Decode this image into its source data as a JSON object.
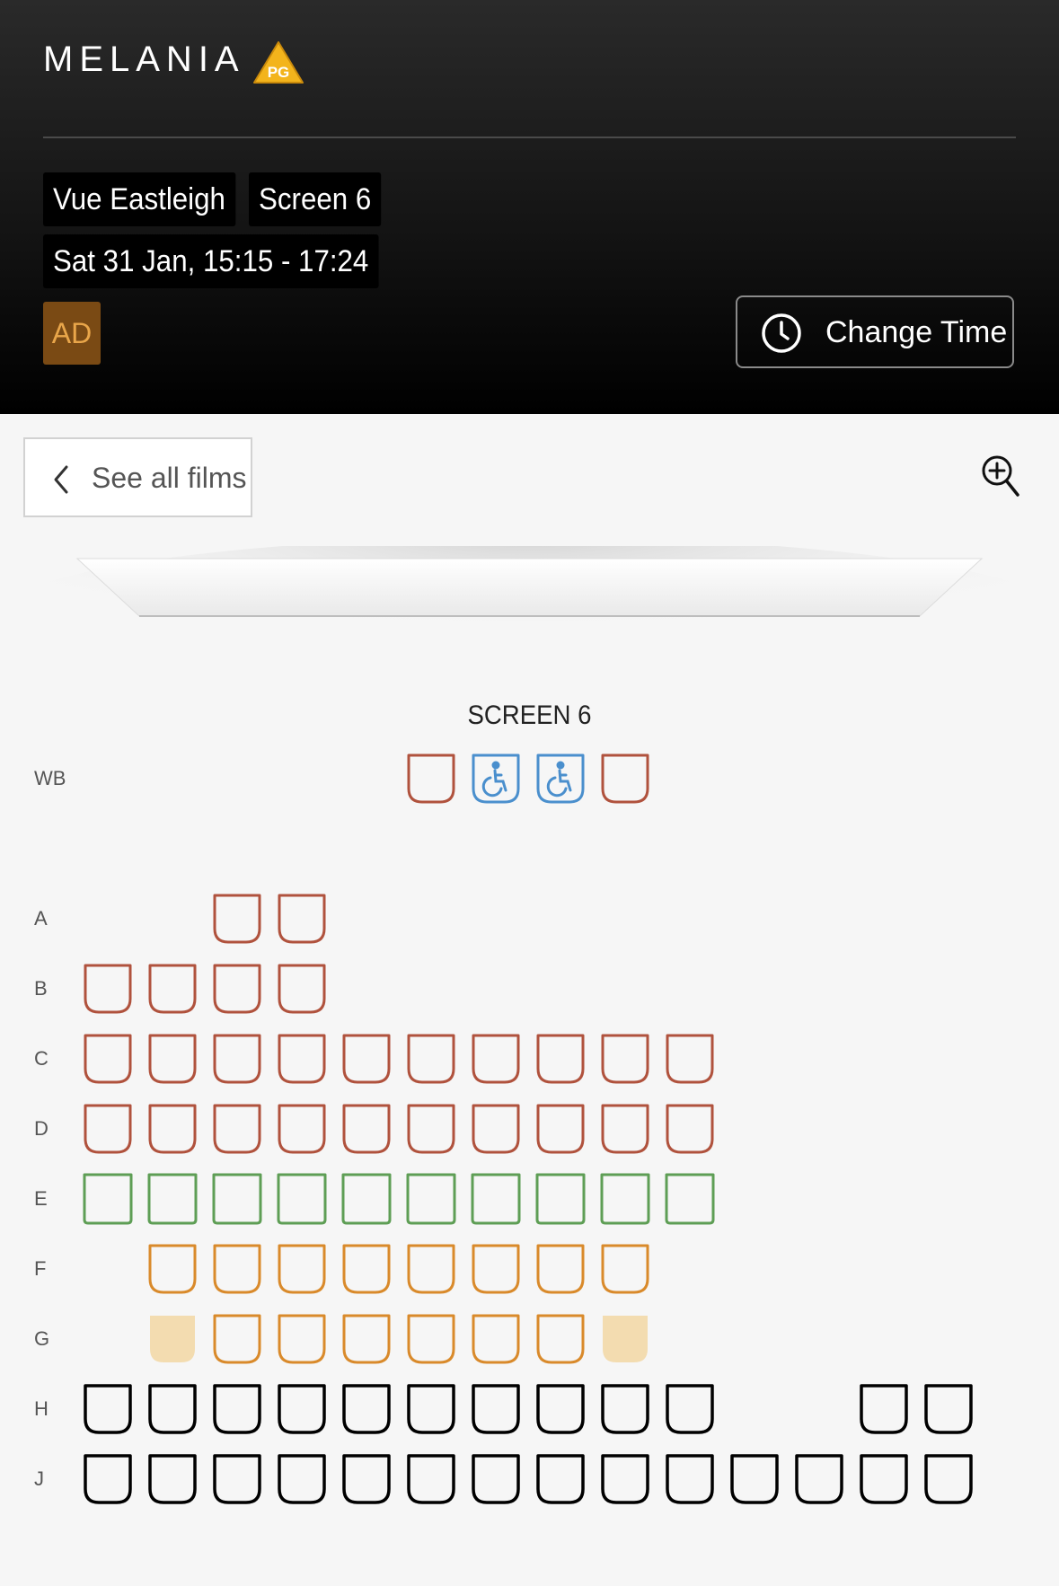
{
  "header": {
    "film_title": "MELANIA",
    "rating": "PG",
    "cinema": "Vue Eastleigh",
    "screen": "Screen 6",
    "datetime": "Sat 31 Jan, 15:15 - 17:24",
    "accessibility_tag": "AD",
    "change_time_label": "Change Time"
  },
  "nav": {
    "back_label": "See all films"
  },
  "seat_map": {
    "screen_label": "SCREEN 6",
    "colors": {
      "standard": "#b0523d",
      "wheelchair": "#4a8fcd",
      "recliner": "#5e9e55",
      "premium": "#d98a2b",
      "premium_taken": "#f3dcb0",
      "basic": "#000000"
    },
    "rows": [
      {
        "label": "WB",
        "seats": [
          {
            "col": 5,
            "type": "standard"
          },
          {
            "col": 6,
            "type": "wheelchair"
          },
          {
            "col": 7,
            "type": "wheelchair"
          },
          {
            "col": 8,
            "type": "standard"
          }
        ]
      },
      {
        "label": "A",
        "seats": [
          {
            "col": 2,
            "type": "standard"
          },
          {
            "col": 3,
            "type": "standard"
          }
        ]
      },
      {
        "label": "B",
        "seats": [
          {
            "col": 0,
            "type": "standard"
          },
          {
            "col": 1,
            "type": "standard"
          },
          {
            "col": 2,
            "type": "standard"
          },
          {
            "col": 3,
            "type": "standard"
          }
        ]
      },
      {
        "label": "C",
        "seats": [
          {
            "col": 0,
            "type": "standard"
          },
          {
            "col": 1,
            "type": "standard"
          },
          {
            "col": 2,
            "type": "standard"
          },
          {
            "col": 3,
            "type": "standard"
          },
          {
            "col": 4,
            "type": "standard"
          },
          {
            "col": 5,
            "type": "standard"
          },
          {
            "col": 6,
            "type": "standard"
          },
          {
            "col": 7,
            "type": "standard"
          },
          {
            "col": 8,
            "type": "standard"
          },
          {
            "col": 9,
            "type": "standard"
          }
        ]
      },
      {
        "label": "D",
        "seats": [
          {
            "col": 0,
            "type": "standard"
          },
          {
            "col": 1,
            "type": "standard"
          },
          {
            "col": 2,
            "type": "standard"
          },
          {
            "col": 3,
            "type": "standard"
          },
          {
            "col": 4,
            "type": "standard"
          },
          {
            "col": 5,
            "type": "standard"
          },
          {
            "col": 6,
            "type": "standard"
          },
          {
            "col": 7,
            "type": "standard"
          },
          {
            "col": 8,
            "type": "standard"
          },
          {
            "col": 9,
            "type": "standard"
          }
        ]
      },
      {
        "label": "E",
        "seats": [
          {
            "col": 0,
            "type": "recliner"
          },
          {
            "col": 1,
            "type": "recliner"
          },
          {
            "col": 2,
            "type": "recliner"
          },
          {
            "col": 3,
            "type": "recliner"
          },
          {
            "col": 4,
            "type": "recliner"
          },
          {
            "col": 5,
            "type": "recliner"
          },
          {
            "col": 6,
            "type": "recliner"
          },
          {
            "col": 7,
            "type": "recliner"
          },
          {
            "col": 8,
            "type": "recliner"
          },
          {
            "col": 9,
            "type": "recliner"
          }
        ]
      },
      {
        "label": "F",
        "seats": [
          {
            "col": 1,
            "type": "premium"
          },
          {
            "col": 2,
            "type": "premium"
          },
          {
            "col": 3,
            "type": "premium"
          },
          {
            "col": 4,
            "type": "premium"
          },
          {
            "col": 5,
            "type": "premium"
          },
          {
            "col": 6,
            "type": "premium"
          },
          {
            "col": 7,
            "type": "premium"
          },
          {
            "col": 8,
            "type": "premium"
          }
        ]
      },
      {
        "label": "G",
        "seats": [
          {
            "col": 1,
            "type": "premium_taken"
          },
          {
            "col": 2,
            "type": "premium"
          },
          {
            "col": 3,
            "type": "premium"
          },
          {
            "col": 4,
            "type": "premium"
          },
          {
            "col": 5,
            "type": "premium"
          },
          {
            "col": 6,
            "type": "premium"
          },
          {
            "col": 7,
            "type": "premium"
          },
          {
            "col": 8,
            "type": "premium_taken"
          }
        ]
      },
      {
        "label": "H",
        "seats": [
          {
            "col": 0,
            "type": "basic"
          },
          {
            "col": 1,
            "type": "basic"
          },
          {
            "col": 2,
            "type": "basic"
          },
          {
            "col": 3,
            "type": "basic"
          },
          {
            "col": 4,
            "type": "basic"
          },
          {
            "col": 5,
            "type": "basic"
          },
          {
            "col": 6,
            "type": "basic"
          },
          {
            "col": 7,
            "type": "basic"
          },
          {
            "col": 8,
            "type": "basic"
          },
          {
            "col": 9,
            "type": "basic"
          },
          {
            "col": 12,
            "type": "basic"
          },
          {
            "col": 13,
            "type": "basic"
          }
        ]
      },
      {
        "label": "J",
        "seats": [
          {
            "col": 0,
            "type": "basic"
          },
          {
            "col": 1,
            "type": "basic"
          },
          {
            "col": 2,
            "type": "basic"
          },
          {
            "col": 3,
            "type": "basic"
          },
          {
            "col": 4,
            "type": "basic"
          },
          {
            "col": 5,
            "type": "basic"
          },
          {
            "col": 6,
            "type": "basic"
          },
          {
            "col": 7,
            "type": "basic"
          },
          {
            "col": 8,
            "type": "basic"
          },
          {
            "col": 9,
            "type": "basic"
          },
          {
            "col": 10,
            "type": "basic"
          },
          {
            "col": 11,
            "type": "basic"
          },
          {
            "col": 12,
            "type": "basic"
          },
          {
            "col": 13,
            "type": "basic"
          }
        ]
      }
    ]
  }
}
